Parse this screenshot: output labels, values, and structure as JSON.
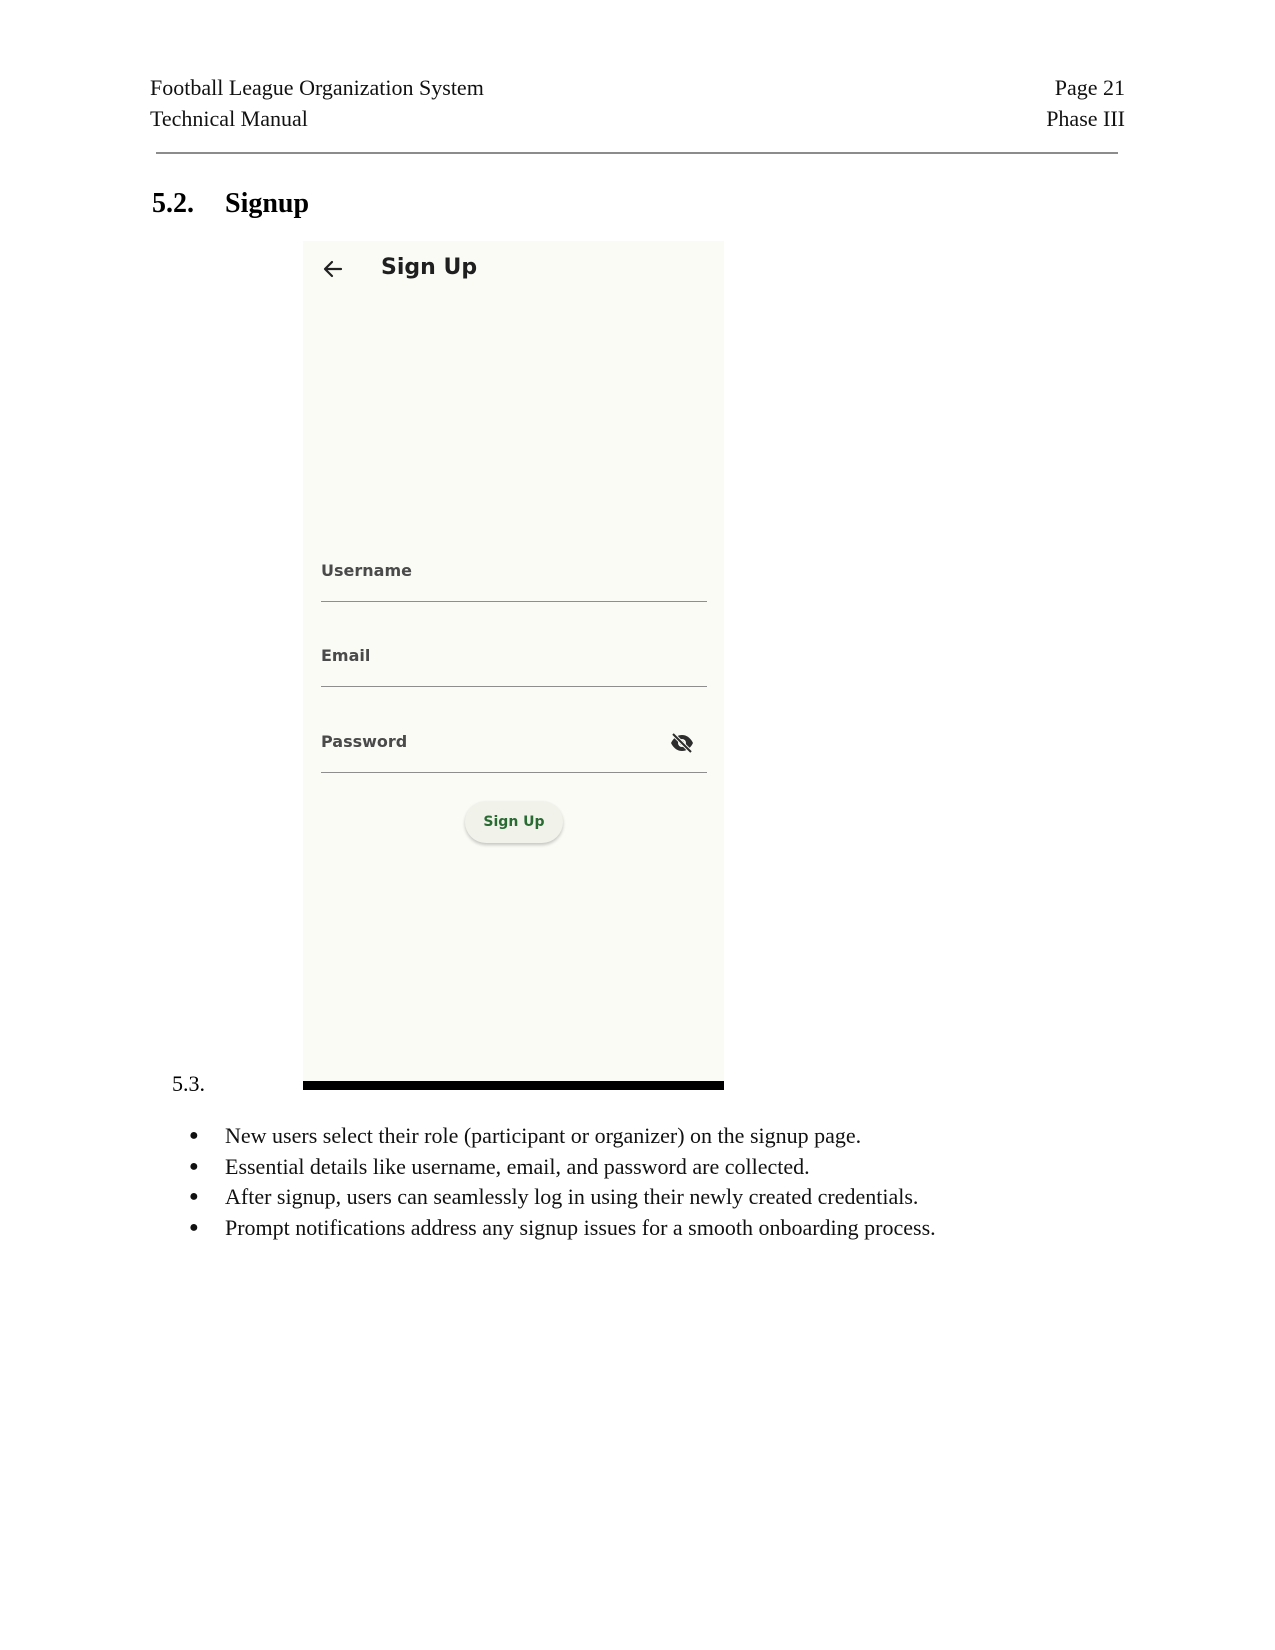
{
  "header": {
    "left_line1": "Football League Organization System",
    "left_line2": "Technical Manual",
    "right_line1": "Page 21",
    "right_line2": "Phase III"
  },
  "section": {
    "number": "5.2.",
    "title": "Signup"
  },
  "app": {
    "title": "Sign Up",
    "back_icon": "arrow-left-icon",
    "fields": {
      "username_label": "Username",
      "email_label": "Email",
      "password_label": "Password",
      "password_toggle_icon": "eye-off-icon"
    },
    "signup_button": "Sign Up",
    "colors": {
      "background": "#fbfbf6",
      "button_text": "#2a6b34",
      "button_bg": "#f1f2ea"
    }
  },
  "next_section_number": "5.3.",
  "bullets": [
    "New users select their role (participant or organizer) on the signup page.",
    "Essential details like username, email, and password are collected.",
    "After signup, users can seamlessly log in using their newly created credentials.",
    "Prompt notifications address any signup issues for a smooth onboarding process."
  ]
}
